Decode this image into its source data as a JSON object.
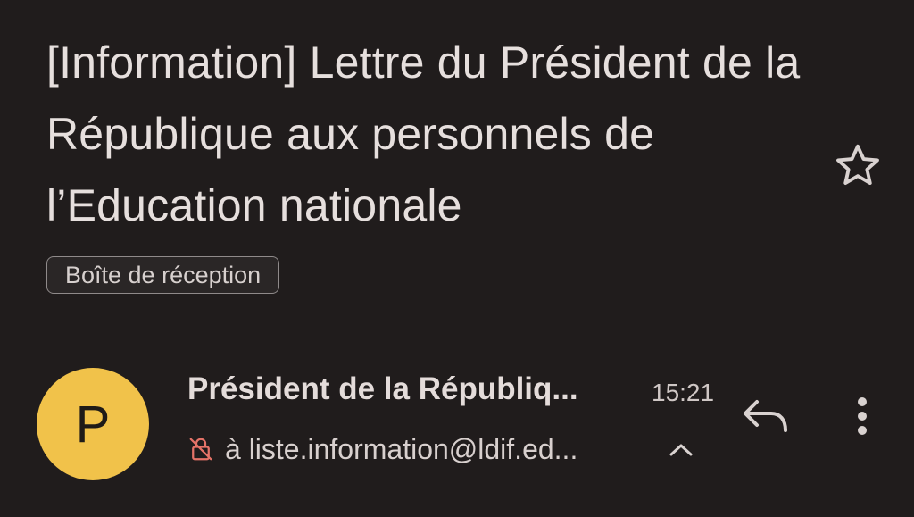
{
  "email": {
    "subject": "[Information] Lettre du Président de la République aux personnels de l’Education nationale",
    "label": "Boîte de réception",
    "sender": {
      "avatar_letter": "P",
      "avatar_color": "#f1c24a",
      "name": "Président de la Républiq...",
      "time": "15:21",
      "recipient": "à liste.information@ldif.ed..."
    },
    "icons": {
      "star": "star-outline-icon",
      "lock": "lock-crossed-icon",
      "chevron": "chevron-up-icon",
      "reply": "reply-icon",
      "more": "more-vert-icon"
    }
  }
}
